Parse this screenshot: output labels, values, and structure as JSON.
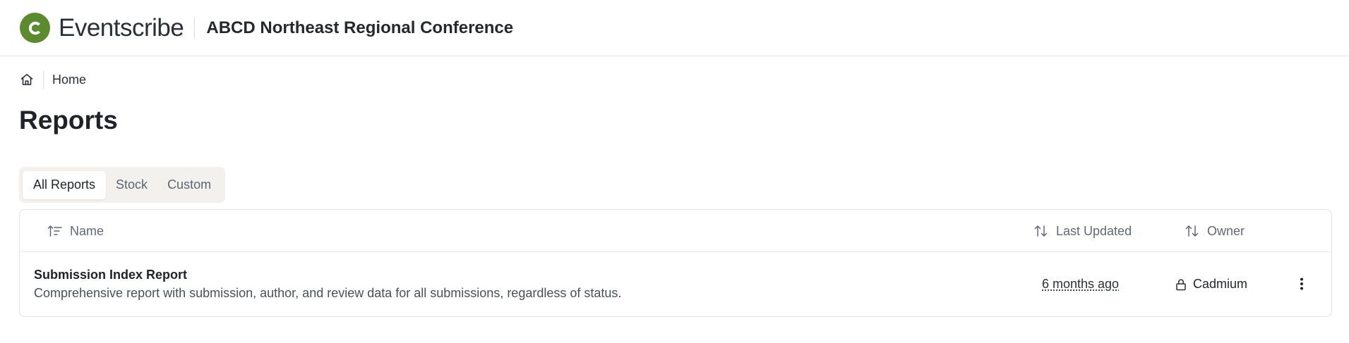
{
  "header": {
    "brand": "Eventscribe",
    "conference": "ABCD Northeast Regional Conference"
  },
  "breadcrumb": {
    "home_label": "Home"
  },
  "page": {
    "title": "Reports"
  },
  "tabs": [
    {
      "label": "All Reports",
      "active": true
    },
    {
      "label": "Stock",
      "active": false
    },
    {
      "label": "Custom",
      "active": false
    }
  ],
  "table": {
    "columns": {
      "name": "Name",
      "last_updated": "Last Updated",
      "owner": "Owner"
    },
    "rows": [
      {
        "name": "Submission Index Report",
        "description": "Comprehensive report with submission, author, and review data for all submissions, regardless of status.",
        "last_updated": "6 months ago",
        "owner": "Cadmium"
      }
    ]
  },
  "colors": {
    "brand_green": "#5b8a2f",
    "tab_bg": "#f2f1ed"
  }
}
